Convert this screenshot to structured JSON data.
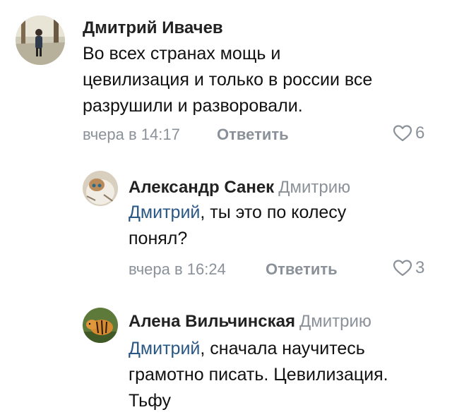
{
  "comments": [
    {
      "author": "Дмитрий Ивачев",
      "reply_to": "",
      "mention": "",
      "text_lines": [
        "Во всех странах мощь и",
        "цевилизация и только в россии все",
        "разрушили и разворовали."
      ],
      "time": "вчера в 14:17",
      "reply_label": "Ответить",
      "likes": "6"
    },
    {
      "author": "Александр Санек",
      "reply_to": "Дмитрию",
      "mention": "Дмитрий",
      "text_lines": [
        ", ты это по колесу",
        "понял?"
      ],
      "time": "вчера в 16:24",
      "reply_label": "Ответить",
      "likes": "3"
    },
    {
      "author": "Алена Вильчинская",
      "reply_to": "Дмитрию",
      "mention": "Дмитрий",
      "text_lines": [
        ", сначала научитесь",
        "грамотно писать. Цевилизация.",
        "Тьфу"
      ],
      "time": "",
      "reply_label": "",
      "likes": ""
    }
  ],
  "icons": {
    "like": "heart-outline-icon"
  },
  "colors": {
    "mention": "#2a5885",
    "muted": "#8a9199"
  }
}
